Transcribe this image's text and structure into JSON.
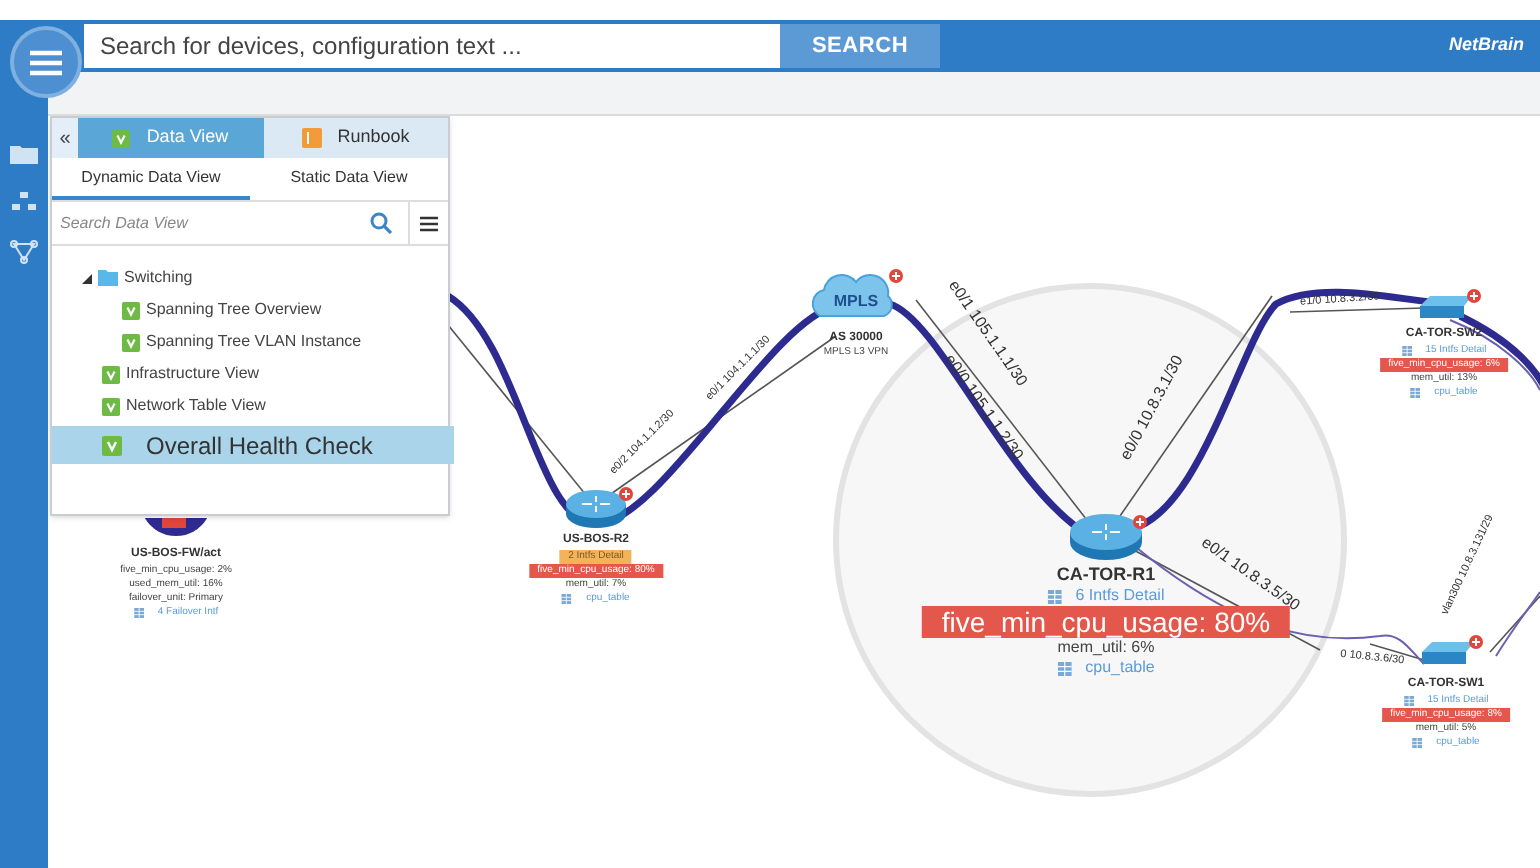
{
  "topbar": {
    "search": {
      "placeholder": "Search for devices, configuration text ..."
    },
    "search_button": "SEARCH",
    "logo": "NetBrain"
  },
  "panel": {
    "collapse": "«",
    "tabs": [
      {
        "label": "Data View",
        "kind": "data",
        "selected": true
      },
      {
        "label": "Runbook",
        "kind": "runbook",
        "selected": false
      }
    ],
    "subtabs": [
      {
        "label": "Dynamic Data View",
        "selected": true
      },
      {
        "label": "Static Data View",
        "selected": false
      }
    ],
    "search": {
      "placeholder": "Search Data View"
    },
    "tree": [
      {
        "label": "Switching",
        "kind": "folder",
        "expanded": true,
        "selected": false,
        "children": [
          {
            "label": "Spanning Tree Overview",
            "kind": "view",
            "selected": false
          },
          {
            "label": "Spanning Tree VLAN Instance",
            "kind": "view",
            "selected": false
          }
        ]
      },
      {
        "label": "Infrastructure View",
        "kind": "view",
        "selected": false
      },
      {
        "label": "Network Table View",
        "kind": "view",
        "selected": false
      },
      {
        "label": "Overall Health Check",
        "kind": "view",
        "selected": true
      }
    ]
  },
  "map": {
    "nodes": [
      {
        "name": "US-BOS-FW/act",
        "kind": "firewall",
        "badge": false,
        "magnified": false,
        "lines": [
          {
            "text": "five_min_cpu_usage: 2%",
            "kind": "metric"
          },
          {
            "text": "used_mem_util: 16%",
            "kind": "metric"
          },
          {
            "text": "failover_unit: Primary",
            "kind": "metric"
          },
          {
            "text": "4 Failover Intf",
            "kind": "link"
          }
        ]
      },
      {
        "name": "US-BOS-R2",
        "kind": "router",
        "badge": true,
        "magnified": false,
        "lines": [
          {
            "text": "2 Intfs Detail",
            "kind": "highlight"
          },
          {
            "text": "five_min_cpu_usage: 80%",
            "kind": "alert"
          },
          {
            "text": "mem_util: 7%",
            "kind": "metric"
          },
          {
            "text": "cpu_table",
            "kind": "link"
          }
        ]
      },
      {
        "name": "AS 30000",
        "kind": "cloud",
        "cloud_label": "MPLS",
        "badge": true,
        "magnified": false,
        "lines": [
          {
            "text": "MPLS L3 VPN",
            "kind": "metric"
          }
        ]
      },
      {
        "name": "CA-TOR-R1",
        "kind": "router",
        "badge": true,
        "magnified": true,
        "lines": [
          {
            "text": "6 Intfs Detail",
            "kind": "link"
          },
          {
            "text": "five_min_cpu_usage: 80%",
            "kind": "alert"
          },
          {
            "text": "mem_util: 6%",
            "kind": "metric"
          },
          {
            "text": "cpu_table",
            "kind": "link"
          }
        ]
      },
      {
        "name": "CA-TOR-SW2",
        "kind": "switch",
        "badge": true,
        "magnified": false,
        "lines": [
          {
            "text": "15 Intfs Detail",
            "kind": "link"
          },
          {
            "text": "five_min_cpu_usage: 6%",
            "kind": "alert"
          },
          {
            "text": "mem_util: 13%",
            "kind": "metric"
          },
          {
            "text": "cpu_table",
            "kind": "link"
          }
        ]
      },
      {
        "name": "CA-TOR-SW1",
        "kind": "switch",
        "badge": true,
        "magnified": false,
        "lines": [
          {
            "text": "15 Intfs Detail",
            "kind": "link"
          },
          {
            "text": "five_min_cpu_usage: 8%",
            "kind": "alert"
          },
          {
            "text": "mem_util: 5%",
            "kind": "metric"
          },
          {
            "text": "cpu_table",
            "kind": "link"
          }
        ]
      }
    ],
    "link_labels": [
      "e0/2 104.1.1.2/30",
      "e0/1 104.1.1.1/30",
      "e0/1 105.1.1.1/30",
      "e0/0 105.1.1.2/30",
      "e0/0 10.8.3.1/30",
      "e1/0 10.8.3.2/30",
      "e0/1 10.8.3.5/30",
      "0 10.8.3.6/30",
      "vlan300 10.8.3.131/29"
    ]
  }
}
